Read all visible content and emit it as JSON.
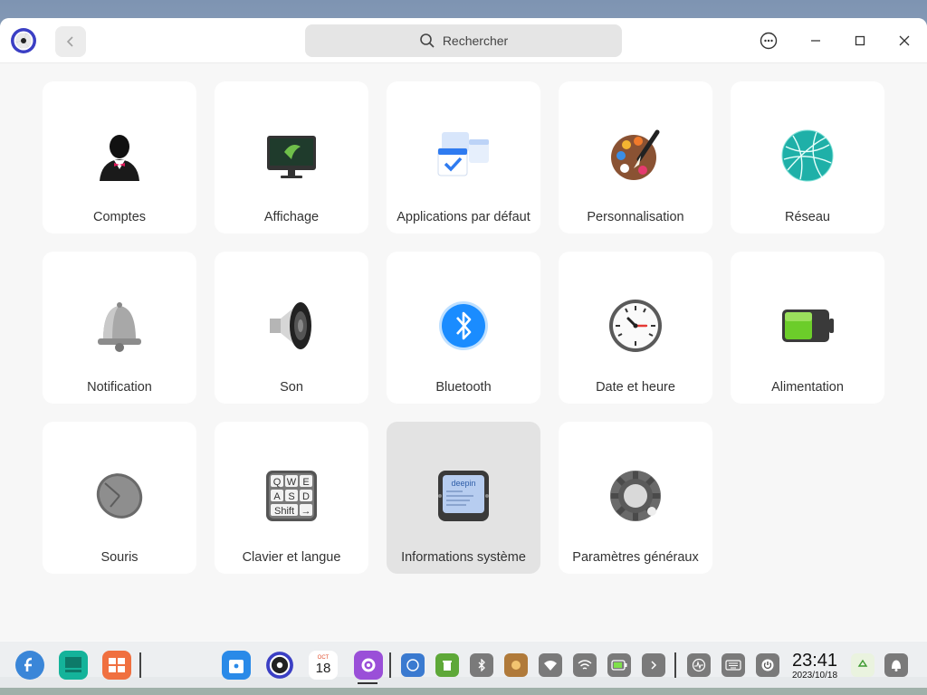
{
  "search": {
    "placeholder": "Rechercher"
  },
  "tiles": [
    {
      "label": "Comptes",
      "icon": "accounts-icon"
    },
    {
      "label": "Affichage",
      "icon": "display-icon"
    },
    {
      "label": "Applications par défaut",
      "icon": "default-apps-icon"
    },
    {
      "label": "Personnalisation",
      "icon": "personalization-icon"
    },
    {
      "label": "Réseau",
      "icon": "network-icon"
    },
    {
      "label": "Notification",
      "icon": "notification-bell-icon"
    },
    {
      "label": "Son",
      "icon": "sound-speaker-icon"
    },
    {
      "label": "Bluetooth",
      "icon": "bluetooth-icon"
    },
    {
      "label": "Date et heure",
      "icon": "clock-icon"
    },
    {
      "label": "Alimentation",
      "icon": "battery-icon"
    },
    {
      "label": "Souris",
      "icon": "mouse-icon"
    },
    {
      "label": "Clavier et langue",
      "icon": "keyboard-icon"
    },
    {
      "label": "Informations système",
      "icon": "system-info-icon",
      "selected": true
    },
    {
      "label": "Paramètres généraux",
      "icon": "gear-icon"
    }
  ],
  "icon_text": {
    "keyboard": [
      "Q",
      "W",
      "E",
      "A",
      "S",
      "D",
      "Shift",
      "→"
    ],
    "system_info": "deepin",
    "calendar_month": "OCT",
    "calendar_day": "18"
  },
  "dock": {
    "time": "23:41",
    "date": "2023/10/18"
  },
  "colors": {
    "accent": "#1a8cff",
    "window_bg": "#f7f7f7",
    "tile_bg": "#ffffff",
    "tile_selected_bg": "#e3e3e3"
  }
}
